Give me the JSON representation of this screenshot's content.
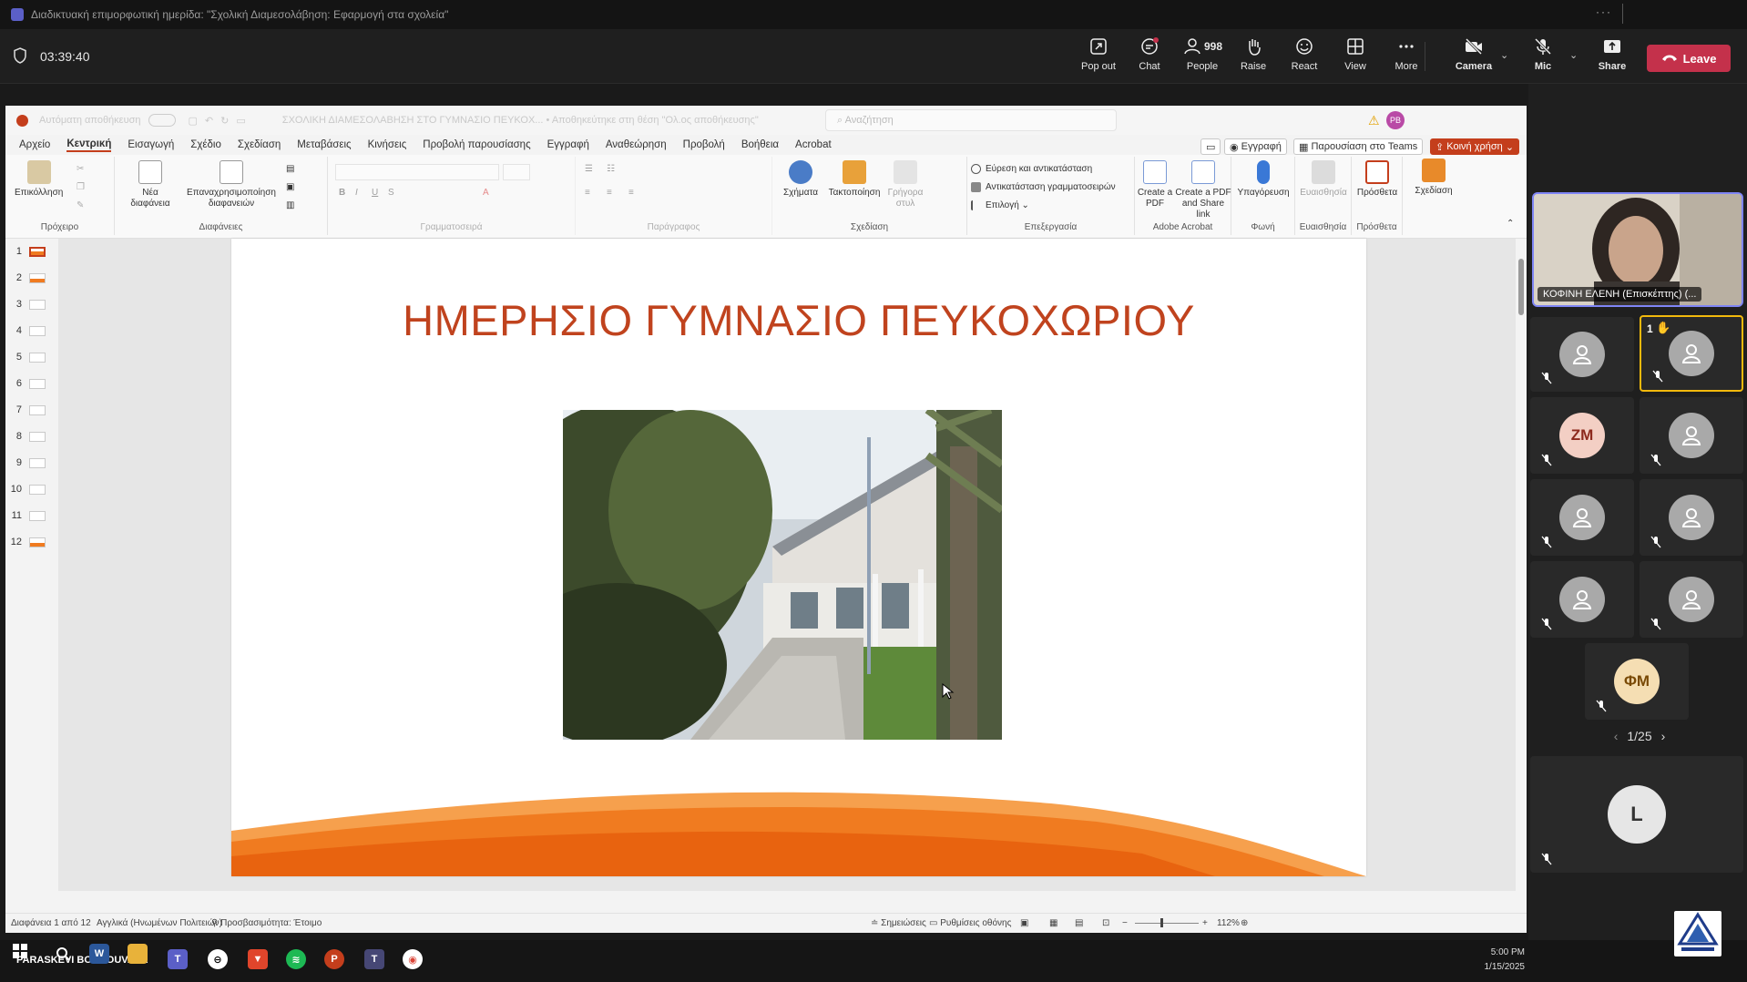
{
  "window": {
    "title": "Διαδικτυακή επιμορφωτική ημερίδα: \"Σχολική Διαμεσολάβηση: Εφαρμογή στα σχολεία\"",
    "more_dots": "···"
  },
  "meeting": {
    "timer": "03:39:40",
    "controls": {
      "popout": "Pop out",
      "chat": "Chat",
      "people": "People",
      "people_count": "998",
      "raise": "Raise",
      "react": "React",
      "view": "View",
      "more": "More",
      "camera": "Camera",
      "mic": "Mic",
      "share": "Share",
      "leave": "Leave"
    }
  },
  "powerpoint": {
    "autosave_label": "Αυτόματη αποθήκευση",
    "doc_title": "ΣΧΟΛΙΚΗ ΔΙΑΜΕΣΟΛΑΒΗΣΗ ΣΤΟ ΓΥΜΝΑΣΙΟ ΠΕΥΚΟΧ...  •  Αποθηκεύτηκε στη θέση \"Ολ.ος αποθήκευσης\"",
    "search_placeholder": "Αναζήτηση",
    "user_initials": "PB",
    "menu_tabs": [
      "Αρχείο",
      "Κεντρική",
      "Εισαγωγή",
      "Σχέδιο",
      "Σχεδίαση",
      "Μεταβάσεις",
      "Κινήσεις",
      "Προβολή παρουσίασης",
      "Εγγραφή",
      "Αναθεώρηση",
      "Προβολή",
      "Βοήθεια",
      "Acrobat"
    ],
    "active_tab": "Κεντρική",
    "right_buttons": {
      "record": "Εγγραφή",
      "present_teams": "Παρουσίαση στο Teams",
      "share": "Κοινή χρήση"
    },
    "ribbon": {
      "paste": "Επικόλληση",
      "clipboard": "Πρόχειρο",
      "new_slide": "Νέα διαφάνεια",
      "reuse_slides": "Επαναχρησιμοποίηση διαφανειών",
      "slides_group": "Διαφάνειες",
      "font_group": "Γραμματοσειρά",
      "paragraph_group": "Παράγραφος",
      "shapes": "Σχήματα",
      "arrange": "Τακτοποίηση",
      "quick_styles": "Γρήγορα στυλ",
      "drawing_group": "Σχεδίαση",
      "find_replace": "Εύρεση και αντικατάσταση",
      "replace_fonts": "Αντικατάσταση γραμματοσειρών",
      "select": "Επιλογή",
      "editing_group": "Επεξεργασία",
      "create_pdf": "Create a PDF",
      "create_pdf_share": "Create a PDF and Share link",
      "acrobat_group": "Adobe Acrobat",
      "dictate": "Υπαγόρευση",
      "voice_group": "Φωνή",
      "sensitivity": "Ευαισθησία",
      "sensitivity_group": "Ευαισθησία",
      "addins": "Πρόσθετα",
      "addins_group": "Πρόσθετα",
      "designer": "Σχεδίαση"
    },
    "thumbnails": [
      "1",
      "2",
      "3",
      "4",
      "5",
      "6",
      "7",
      "8",
      "9",
      "10",
      "11",
      "12"
    ],
    "selected_slide": 1,
    "slide": {
      "title": "ΗΜΕΡΗΣΙΟ ΓΥΜΝΑΣΙΟ ΠΕΥΚΟΧΩΡΙΟΥ"
    },
    "status": {
      "slide_of": "Διαφάνεια 1 από 12",
      "language": "Αγγλικά (Ηνωμένων Πολιτειών)",
      "accessibility": "Προσβασιμότητα: Έτοιμο",
      "notes": "Σημειώσεις",
      "display_settings": "Ρυθμίσεις οθόνης",
      "zoom": "112%"
    }
  },
  "gallery": {
    "featured_name": "ΚΟΦΙΝΗ ΕΛΕΝΗ (Επισκέπτης) (...",
    "raised_count": "1",
    "initials_zm": "ZM",
    "initials_fm": "ΦΜ",
    "initials_l": "L",
    "pager": "1/25"
  },
  "taskbar": {
    "user": "PARASKEVI BOUKOUVALA",
    "time": "5:00 PM",
    "date": "1/15/2025"
  },
  "colors": {
    "leave": "#c4314b",
    "accent": "#c43e1c",
    "teams": "#7f85f5",
    "orange": "#f07b20"
  }
}
